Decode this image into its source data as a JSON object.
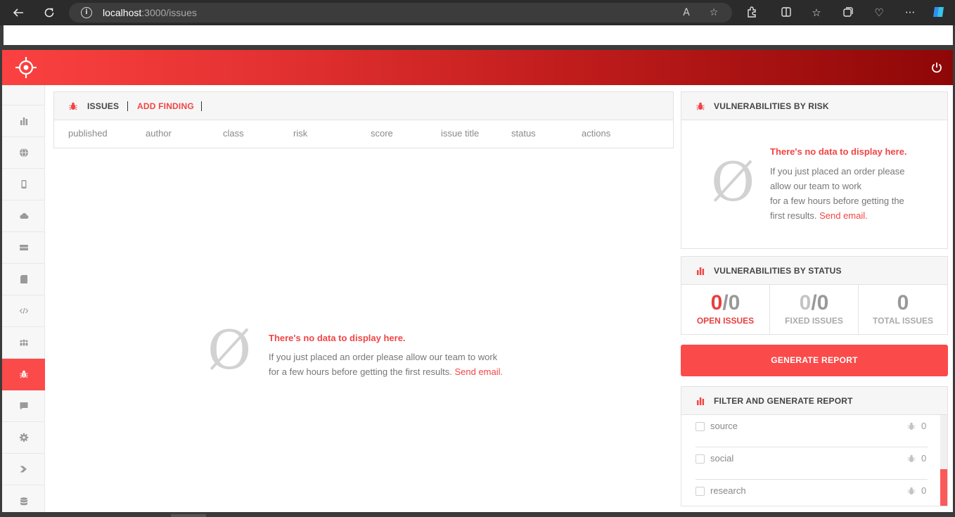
{
  "browser": {
    "url_host": "localhost",
    "url_path": ":3000/issues"
  },
  "colors": {
    "accent": "#fb4a4a",
    "header_start": "#fb4141",
    "header_end": "#8e0707"
  },
  "sidebar": {
    "items": [
      {
        "icon": "bar-chart-icon"
      },
      {
        "icon": "globe-icon"
      },
      {
        "icon": "mobile-icon"
      },
      {
        "icon": "cloud-icon"
      },
      {
        "icon": "server-icon"
      },
      {
        "icon": "sd-card-icon"
      },
      {
        "icon": "code-icon"
      },
      {
        "icon": "users-icon"
      },
      {
        "icon": "bug-icon",
        "active": true
      },
      {
        "icon": "comment-icon"
      },
      {
        "icon": "gear-icon"
      },
      {
        "icon": "chevron-right-icon"
      },
      {
        "icon": "database-icon"
      }
    ]
  },
  "issues": {
    "title": "ISSUES",
    "add_finding": "ADD FINDING",
    "columns": [
      "published",
      "author",
      "class",
      "risk",
      "score",
      "issue title",
      "status",
      "actions"
    ]
  },
  "empty_state": {
    "glyph": "Ø",
    "title": "There's no data to display here.",
    "text_line1": "If you just placed an order please allow our team to work",
    "text_line2": "for a few hours before getting the first results.",
    "link": "Send email."
  },
  "risk_panel": {
    "title": "VULNERABILITIES BY RISK",
    "empty_title": "There's no data to display here.",
    "line1": "If you just placed an order please",
    "line2": "allow our team to work",
    "line3": "for a few hours before getting the",
    "line4": "first results.",
    "link": "Send email."
  },
  "status_panel": {
    "title": "VULNERABILITIES BY STATUS",
    "open": {
      "current": "0",
      "sep": "/",
      "total": "0",
      "label": "OPEN ISSUES"
    },
    "fixed": {
      "current": "0",
      "sep": "/",
      "total": "0",
      "label": "FIXED ISSUES"
    },
    "total": {
      "value": "0",
      "label": "TOTAL ISSUES"
    }
  },
  "generate_report": "GENERATE REPORT",
  "filter_panel": {
    "title": "FILTER AND GENERATE REPORT",
    "rows": [
      {
        "label": "source",
        "count": "0"
      },
      {
        "label": "social",
        "count": "0"
      },
      {
        "label": "research",
        "count": "0"
      }
    ]
  }
}
